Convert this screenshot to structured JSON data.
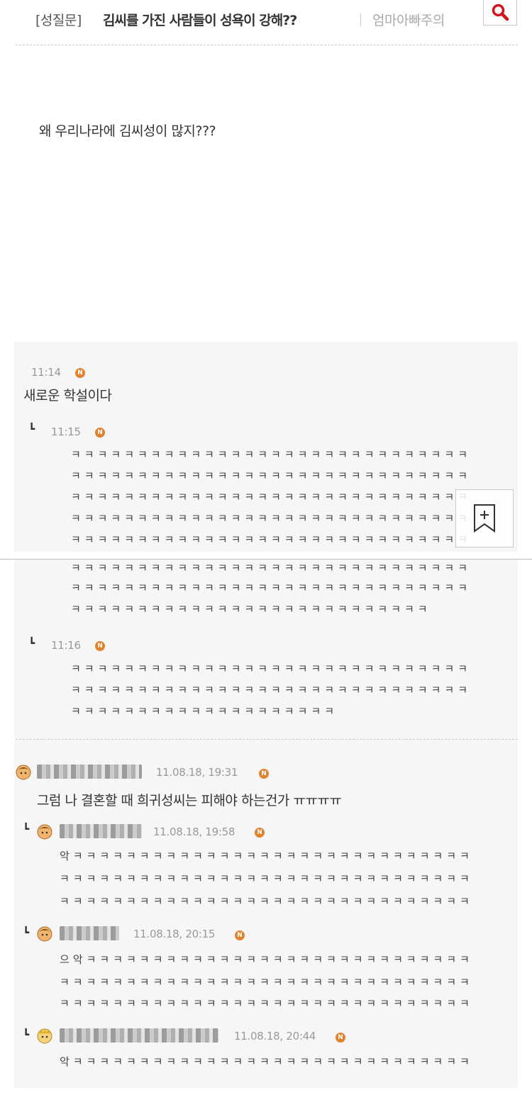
{
  "header": {
    "board_tag": "[성질문]",
    "title": "김씨를 가진 사람들이 성욕이 강해??",
    "board_name": "엄마아빠주의"
  },
  "post": {
    "body": "왜 우리나라에 김씨성이 많지???"
  },
  "badge_label": "N",
  "comments": [
    {
      "time": "11:14",
      "text": "새로운 학설이다",
      "replies": [
        {
          "time": "11:15",
          "lines": [
            "ㅋㅋㅋㅋㅋㅋㅋㅋㅋㅋㅋㅋㅋㅋㅋㅋㅋㅋㅋㅋㅋㅋㅋㅋㅋㅋㅋㅋㅋㅋ",
            "ㅋㅋㅋㅋㅋㅋㅋㅋㅋㅋㅋㅋㅋㅋㅋㅋㅋㅋㅋㅋㅋㅋㅋㅋㅋㅋㅋㅋㅋㅋ",
            "ㅋㅋㅋㅋㅋㅋㅋㅋㅋㅋㅋㅋㅋㅋㅋㅋㅋㅋㅋㅋㅋㅋㅋㅋㅋㅋㅋㅋㅋㅋ",
            "ㅋㅋㅋㅋㅋㅋㅋㅋㅋㅋㅋㅋㅋㅋㅋㅋㅋㅋㅋㅋㅋㅋㅋㅋㅋㅋㅋㅋㅋㅋ",
            "ㅋㅋㅋㅋㅋㅋㅋㅋㅋㅋㅋㅋㅋㅋㅋㅋㅋㅋㅋㅋㅋㅋㅋㅋㅋㅋㅋㅋㅋㅋ",
            "ㅋㅋㅋㅋㅋㅋㅋㅋㅋㅋㅋㅋㅋㅋㅋㅋㅋㅋㅋㅋㅋㅋㅋㅋㅋㅋㅋㅋㅋㅋ",
            "ㅋㅋㅋㅋㅋㅋㅋㅋㅋㅋㅋㅋㅋㅋㅋㅋㅋㅋㅋㅋㅋㅋㅋㅋㅋㅋㅋㅋㅋㅋ",
            "ㅋㅋㅋㅋㅋㅋㅋㅋㅋㅋㅋㅋㅋㅋㅋㅋㅋㅋㅋㅋㅋㅋㅋㅋㅋㅋㅋ"
          ]
        },
        {
          "time": "11:16",
          "lines": [
            "ㅋㅋㅋㅋㅋㅋㅋㅋㅋㅋㅋㅋㅋㅋㅋㅋㅋㅋㅋㅋㅋㅋㅋㅋㅋㅋㅋㅋㅋㅋ",
            "ㅋㅋㅋㅋㅋㅋㅋㅋㅋㅋㅋㅋㅋㅋㅋㅋㅋㅋㅋㅋㅋㅋㅋㅋㅋㅋㅋㅋㅋㅋ",
            "ㅋㅋㅋㅋㅋㅋㅋㅋㅋㅋㅋㅋㅋㅋㅋㅋㅋㅋㅋㅋ"
          ]
        }
      ]
    },
    {
      "time": "11.08.18, 19:31",
      "text": "그럼 나 결혼할 때 희귀성씨는 피해야 하는건가 ㅠㅠㅠㅠ",
      "replies": [
        {
          "time": "11.08.18, 19:58",
          "lines": [
            "악ㅋㅋㅋㅋㅋㅋㅋㅋㅋㅋㅋㅋㅋㅋㅋㅋㅋㅋㅋㅋㅋㅋㅋㅋㅋㅋㅋㅋㅋㅋ",
            "ㅋㅋㅋㅋㅋㅋㅋㅋㅋㅋㅋㅋㅋㅋㅋㅋㅋㅋㅋㅋㅋㅋㅋㅋㅋㅋㅋㅋㅋㅋㅋ",
            "ㅋㅋㅋㅋㅋㅋㅋㅋㅋㅋㅋㅋㅋㅋㅋㅋㅋㅋㅋㅋㅋㅋㅋㅋㅋㅋㅋㅋㅋㅋㅋ"
          ]
        },
        {
          "time": "11.08.18, 20:15",
          "lines": [
            "으악ㅋㅋㅋㅋㅋㅋㅋㅋㅋㅋㅋㅋㅋㅋㅋㅋㅋㅋㅋㅋㅋㅋㅋㅋㅋㅋㅋㅋㅋ",
            "ㅋㅋㅋㅋㅋㅋㅋㅋㅋㅋㅋㅋㅋㅋㅋㅋㅋㅋㅋㅋㅋㅋㅋㅋㅋㅋㅋㅋㅋㅋㅋ",
            "ㅋㅋㅋㅋㅋㅋㅋㅋㅋㅋㅋㅋㅋㅋㅋㅋㅋㅋㅋㅋㅋㅋㅋㅋㅋㅋㅋㅋㅋㅋㅋ"
          ]
        },
        {
          "time": "11.08.18, 20:44",
          "lines": [
            "악ㅋㅋㅋㅋㅋㅋㅋㅋㅋㅋㅋㅋㅋㅋㅋㅋㅋㅋㅋㅋㅋㅋㅋㅋㅋㅋㅋㅋㅋㅋ"
          ]
        }
      ]
    }
  ],
  "icons": {
    "search": "search-icon",
    "bookmark": "bookmark-add-icon",
    "avatar": "user-avatar-icon",
    "reply": "reply-arrow-icon",
    "new": "new-badge-icon"
  },
  "colors": {
    "badge": "#e0822e",
    "panel_bg": "#f6f6f6",
    "text": "#333333",
    "time": "#999999"
  }
}
